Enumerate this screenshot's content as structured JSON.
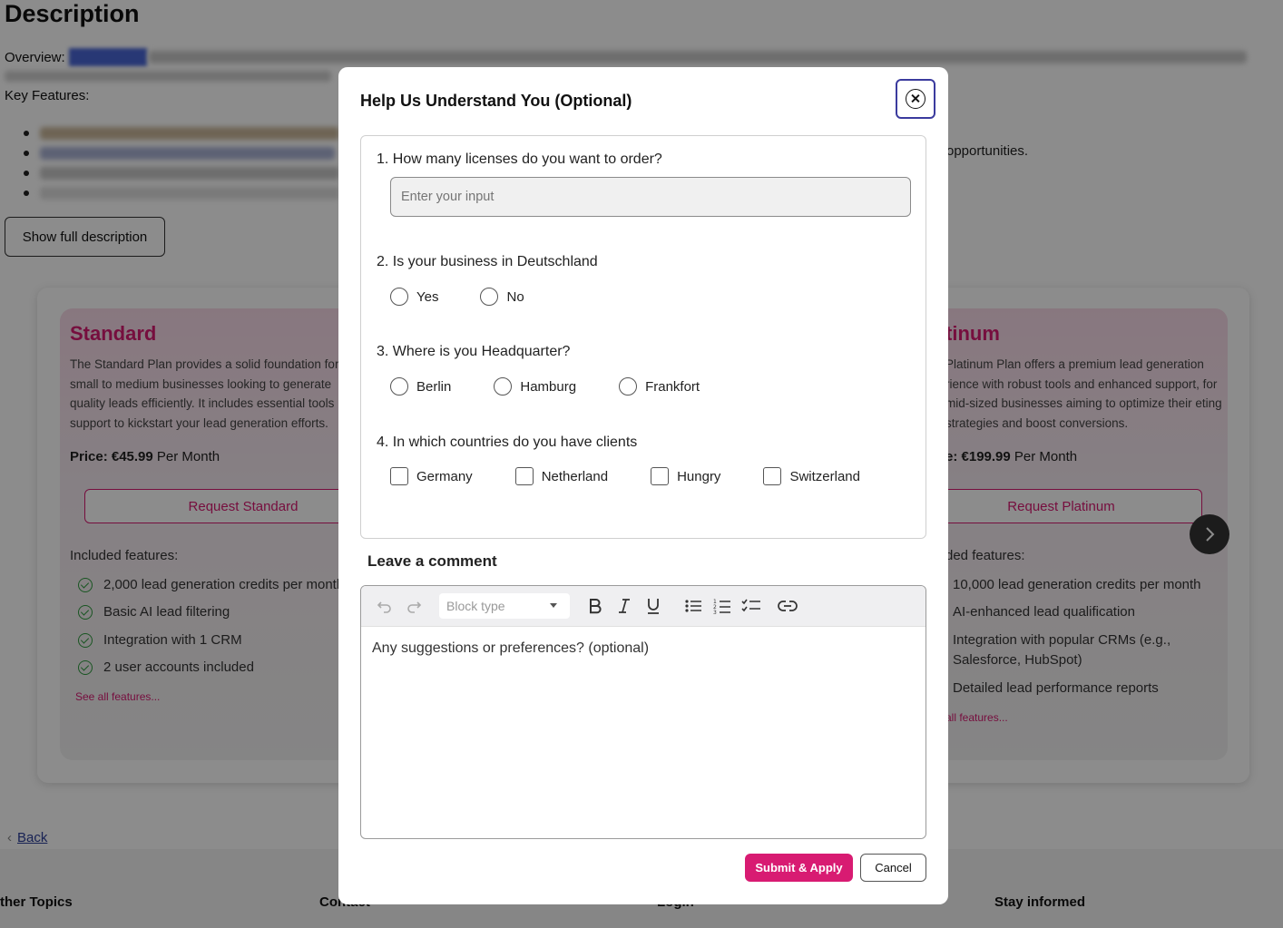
{
  "background": {
    "title": "Description",
    "overview_label": "Overview:",
    "key_features_label": "Key Features:",
    "visible_snippet": "opportunities.",
    "show_full_label": "Show full description",
    "plans": [
      {
        "name": "Standard",
        "description": "The Standard Plan provides a solid foundation for small to medium businesses looking to generate quality leads efficiently. It includes essential tools support to kickstart your lead generation efforts.",
        "price_label": "Price: €45.99",
        "price_period": " Per Month",
        "request_label": "Request Standard",
        "included_label": "Included features:",
        "features": [
          "2,000 lead generation credits per month",
          "Basic AI lead filtering",
          "Integration with 1 CRM",
          "2 user accounts included"
        ],
        "see_all": "See all features..."
      },
      {
        "name": "tinum",
        "description": "Platinum Plan offers a premium lead generation rience with robust tools and enhanced support, for mid-sized businesses aiming to optimize their eting strategies and boost conversions.",
        "price_label": "e: €199.99",
        "price_period": " Per Month",
        "request_label": "Request Platinum",
        "included_label": "ded features:",
        "features": [
          "10,000 lead generation credits per month",
          "AI-enhanced lead qualification",
          "Integration with popular CRMs (e.g., Salesforce, HubSpot)",
          "Detailed lead performance reports"
        ],
        "see_all": "all features..."
      }
    ],
    "back_label": "Back",
    "footer": [
      "ther Topics",
      "Contact",
      "Login",
      "Stay informed"
    ]
  },
  "modal": {
    "title": "Help Us Understand You (Optional)",
    "questions": [
      {
        "label": "1. How many licenses do you want to order?",
        "placeholder": "Enter your input",
        "value": ""
      },
      {
        "label": "2. Is your business in Deutschland",
        "options": [
          "Yes",
          "No"
        ]
      },
      {
        "label": "3. Where is you Headquarter?",
        "options": [
          "Berlin",
          "Hamburg",
          "Frankfort"
        ]
      },
      {
        "label": "4. In which countries do you have clients",
        "options": [
          "Germany",
          "Netherland",
          "Hungry",
          "Switzerland"
        ]
      }
    ],
    "comment_label": "Leave a comment",
    "editor": {
      "block_type_placeholder": "Block type",
      "placeholder": "Any suggestions or preferences? (optional)"
    },
    "submit_label": "Submit & Apply",
    "cancel_label": "Cancel"
  },
  "colors": {
    "accent": "#d81b72",
    "focus_ring": "#3b3b9e",
    "check_green": "#2e9b3e"
  }
}
